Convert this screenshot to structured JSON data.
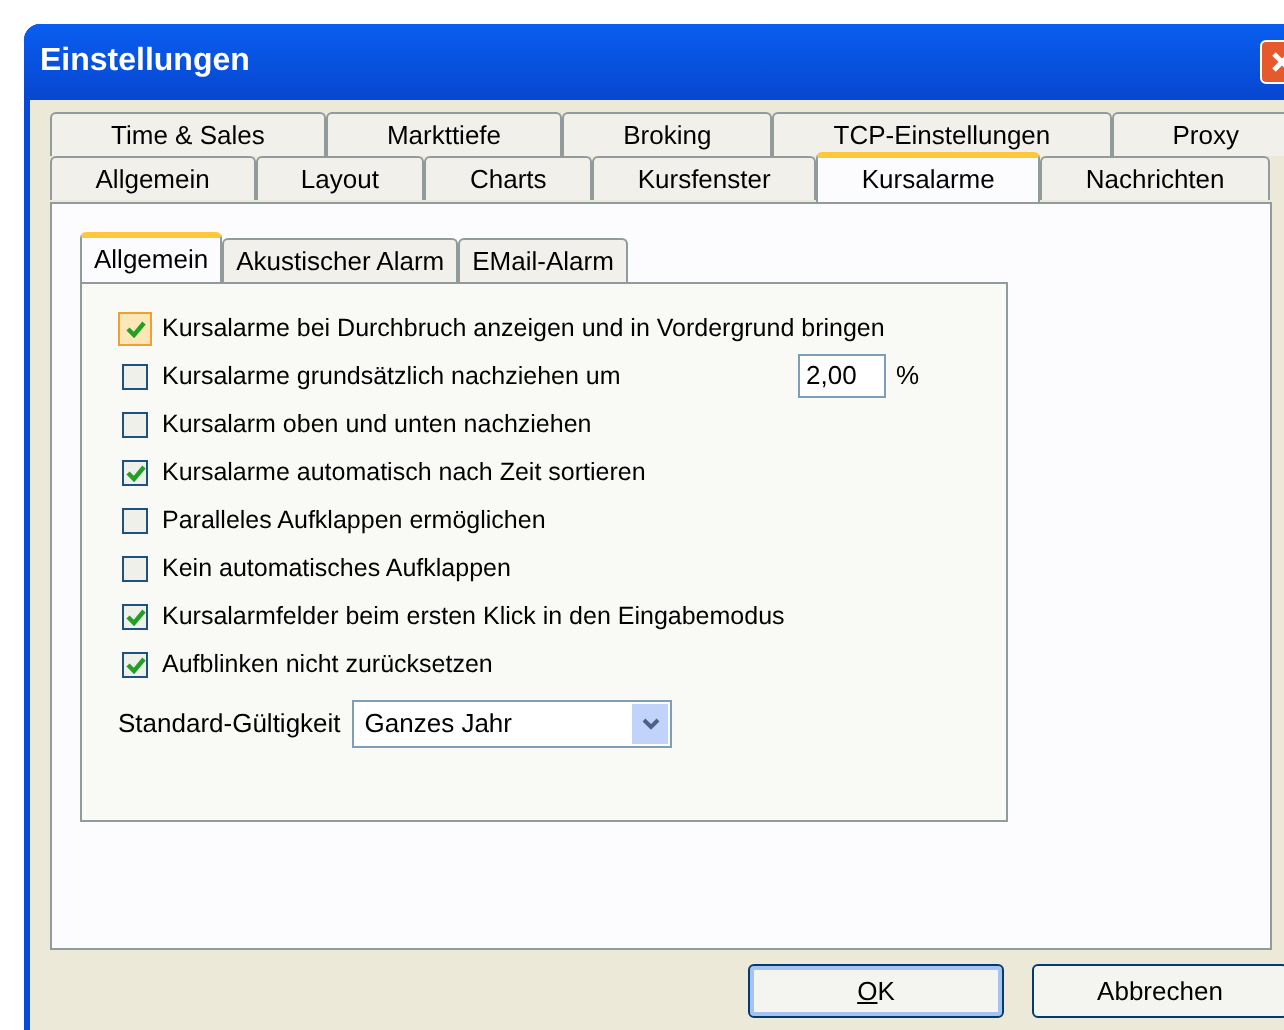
{
  "window": {
    "title": "Einstellungen"
  },
  "tab_rows": [
    [
      {
        "label": "Time & Sales",
        "selected": false
      },
      {
        "label": "Markttiefe",
        "selected": false
      },
      {
        "label": "Broking",
        "selected": false
      },
      {
        "label": "TCP-Einstellungen",
        "selected": false
      },
      {
        "label": "Proxy",
        "selected": false
      }
    ],
    [
      {
        "label": "Allgemein",
        "selected": false
      },
      {
        "label": "Layout",
        "selected": false
      },
      {
        "label": "Charts",
        "selected": false
      },
      {
        "label": "Kursfenster",
        "selected": false
      },
      {
        "label": "Kursalarme",
        "selected": true
      },
      {
        "label": "Nachrichten",
        "selected": false
      }
    ]
  ],
  "sub_tabs": [
    {
      "label": "Allgemein",
      "selected": true
    },
    {
      "label": "Akustischer Alarm",
      "selected": false
    },
    {
      "label": "EMail-Alarm",
      "selected": false
    }
  ],
  "options": [
    {
      "label": "Kursalarme bei Durchbruch anzeigen und in Vordergrund bringen",
      "checked": true,
      "focused": true
    },
    {
      "label": "Kursalarme grundsätzlich nachziehen um",
      "checked": false,
      "focused": false,
      "value": "2,00",
      "unit": "%"
    },
    {
      "label": "Kursalarm oben und unten nachziehen",
      "checked": false,
      "focused": false
    },
    {
      "label": "Kursalarme automatisch nach Zeit sortieren",
      "checked": true,
      "focused": false
    },
    {
      "label": "Paralleles Aufklappen ermöglichen",
      "checked": false,
      "focused": false
    },
    {
      "label": "Kein automatisches Aufklappen",
      "checked": false,
      "focused": false
    },
    {
      "label": "Kursalarmfelder beim ersten Klick in den Eingabemodus",
      "checked": true,
      "focused": false
    },
    {
      "label": "Aufblinken nicht zurücksetzen",
      "checked": true,
      "focused": false
    }
  ],
  "validity": {
    "label": "Standard-Gültigkeit",
    "value": "Ganzes Jahr"
  },
  "buttons": [
    {
      "label": "OK",
      "default": true
    },
    {
      "label": "Abbrechen",
      "default": false
    }
  ]
}
